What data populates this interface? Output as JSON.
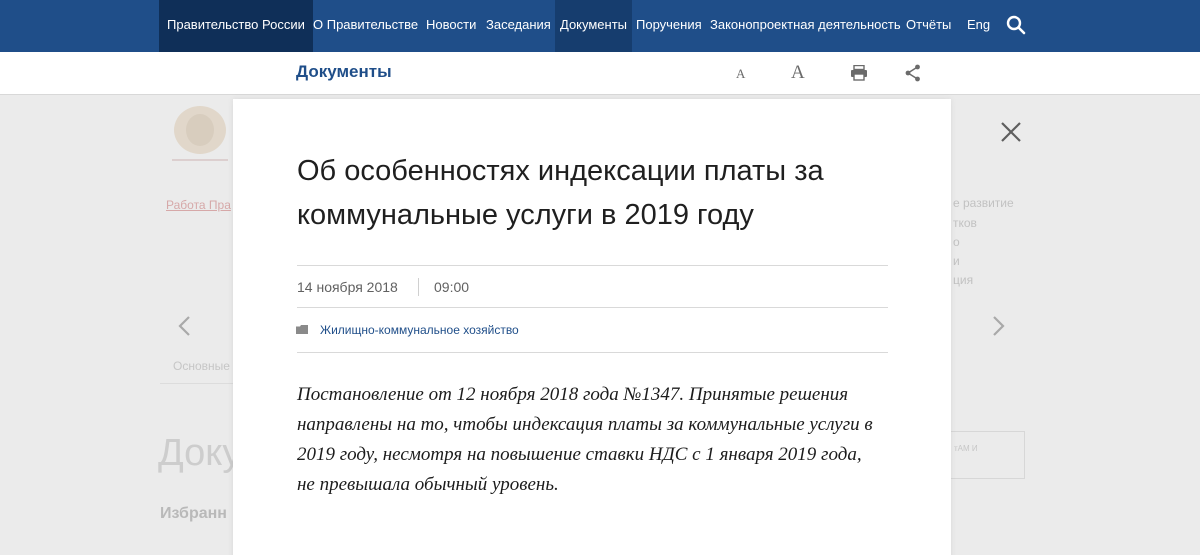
{
  "nav": {
    "brand": "Правительство России",
    "items": [
      "О Правительстве",
      "Новости",
      "Заседания",
      "Документы",
      "Поручения",
      "Законопроектная деятельность",
      "Отчёты",
      "Eng"
    ]
  },
  "subbar": {
    "title": "Документы",
    "font_small": "A",
    "font_large": "A"
  },
  "background": {
    "link_left": "Работа Пра",
    "right_lines": [
      "е развитие",
      "тков",
      "о",
      "и",
      "ция"
    ],
    "under_label": "Основные",
    "big_heading": "Доку",
    "sub_heading": "Избранн",
    "button_text": "тАМ И"
  },
  "modal": {
    "title": "Об особенностях индексации платы за коммунальные услуги в 2019 году",
    "date": "14 ноября 2018",
    "time": "09:00",
    "tag": "Жилищно-коммунальное хозяйство",
    "lead": "Постановление от 12 ноября 2018 года №1347. Принятые решения направлены на то, чтобы индексация платы за коммунальные услуги в 2019 году, несмотря на повышение ставки НДС с 1 января 2019 года, не превышала обычный уровень."
  },
  "colors": {
    "nav_bg": "#1f4e89",
    "nav_brand_bg": "#0f2f58",
    "accent": "#1f4e89"
  },
  "icons": [
    "search-icon",
    "print-icon",
    "share-icon",
    "close-icon",
    "folder-icon",
    "chevron-left-icon",
    "chevron-right-icon",
    "emblem-icon"
  ]
}
